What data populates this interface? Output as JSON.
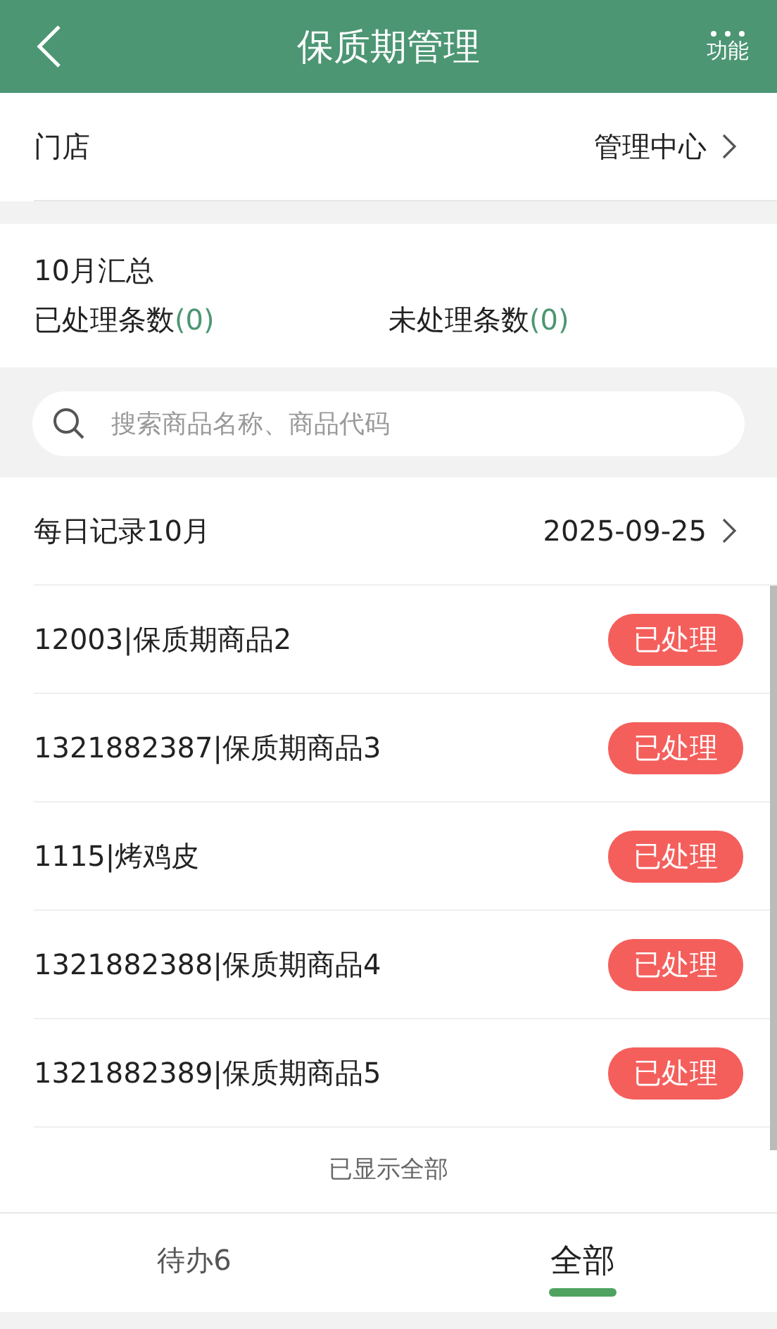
{
  "header": {
    "title": "保质期管理",
    "menu_label": "功能"
  },
  "store": {
    "label": "门店",
    "value": "管理中心"
  },
  "summary": {
    "title": "10月汇总",
    "counts": [
      {
        "label": "已处理条数",
        "value": "(0)"
      },
      {
        "label": "未处理条数",
        "value": "(0)"
      }
    ]
  },
  "search": {
    "placeholder": "搜索商品名称、商品代码"
  },
  "records": {
    "title": "每日记录10月",
    "date": "2025-09-25",
    "items": [
      {
        "name": "12003|保质期商品2",
        "status": "已处理"
      },
      {
        "name": "1321882387|保质期商品3",
        "status": "已处理"
      },
      {
        "name": "1115|烤鸡皮",
        "status": "已处理"
      },
      {
        "name": "1321882388|保质期商品4",
        "status": "已处理"
      },
      {
        "name": "1321882389|保质期商品5",
        "status": "已处理"
      }
    ],
    "footer": "已显示全部"
  },
  "tabs": [
    {
      "label": "待办6",
      "selected": false
    },
    {
      "label": "全部",
      "selected": true
    }
  ]
}
